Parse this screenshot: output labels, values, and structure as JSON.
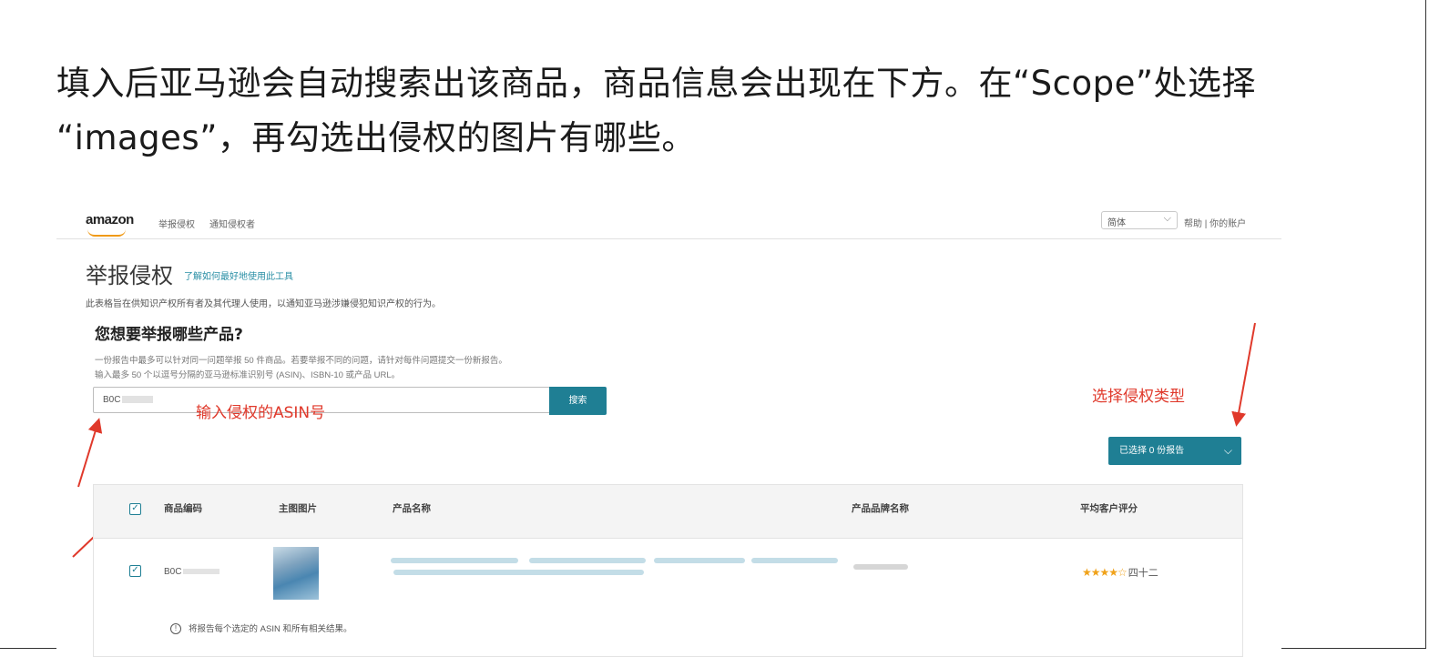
{
  "caption": {
    "line1": "填入后亚马逊会自动搜索出该商品，商品信息会出现在下方。在“Scope”处选择",
    "line2": "“images”，再勾选出侵权的图片有哪些。"
  },
  "topbar": {
    "logo": "amazon",
    "nav_items": [
      "举报侵权",
      "通知侵权者"
    ],
    "language": "简体",
    "help_links": "帮助 | 你的账户"
  },
  "page": {
    "title": "举报侵权",
    "title_link": "了解如何最好地使用此工具",
    "intro": "此表格旨在供知识产权所有者及其代理人使用，以通知亚马逊涉嫌侵犯知识产权的行为。",
    "question": "您想要举报哪些产品?",
    "hint_line1": "一份报告中最多可以针对同一问题举报 50 件商品。若要举报不同的问题，请针对每件问题提交一份新报告。",
    "hint_line2": "输入最多 50 个以逗号分隔的亚马逊标准识别号 (ASIN)、ISBN-10 或产品 URL。",
    "search_value": "B0C",
    "search_button": "搜索",
    "report_button": "已选择 0 份报告"
  },
  "annotations": {
    "asin": "输入侵权的ASIN号",
    "type": "选择侵权类型",
    "color": "#e0392b"
  },
  "table": {
    "headers": [
      "商品编码",
      "主图图片",
      "产品名称",
      "产品品牌名称",
      "平均客户评分"
    ],
    "rows": [
      {
        "asin": "B0C",
        "checked": true,
        "rating_text": "四十二"
      }
    ],
    "note": "将报告每个选定的 ASIN 和所有相关结果。"
  },
  "colors": {
    "accent": "#1f7f94",
    "star": "#f0a21a"
  }
}
